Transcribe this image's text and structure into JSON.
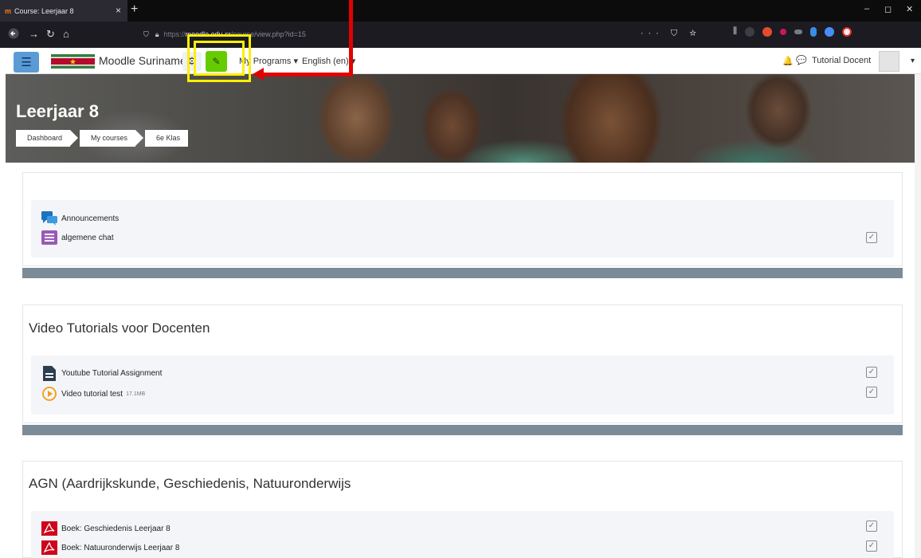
{
  "browser": {
    "tab_title": "Course: Leerjaar 8",
    "tab_logo": "m",
    "tab_close": "×",
    "new_tab": "+",
    "url_host": "moodle.edu.sr",
    "url_path": "/course/view.php?id=15",
    "url_prefix": "https://",
    "url_actions": "··· ⛉ ☆",
    "window_controls": [
      "–",
      "◻",
      "✕"
    ],
    "nav_icons": [
      "back-icon",
      "forward-icon",
      "reload-icon",
      "home-icon"
    ]
  },
  "moodle_nav": {
    "menu_icon": "☰",
    "brand": "Moodle Suriname",
    "gear_icon": "⚙",
    "edit_icon": "✎",
    "my_programs": "My Programs ▾",
    "language": "English (en) ▾",
    "bell_icon": "🔔",
    "chat_icon": "💬",
    "user_name": "Tutorial Docent",
    "user_caret": "▾",
    "flag_colors": [
      "#377e3f",
      "#ffffff",
      "#b40a2d",
      "#ecc81d"
    ]
  },
  "header": {
    "title": "Leerjaar 8",
    "breadcrumbs": [
      "Dashboard",
      "My courses",
      "6e Klas"
    ]
  },
  "sections": [
    {
      "title": "",
      "activities": [
        {
          "name": "Announcements",
          "icon": "forum-icon",
          "color": "#1e73be"
        },
        {
          "name": "algemene chat",
          "icon": "chat-icon",
          "color": "#9b59b6"
        }
      ]
    },
    {
      "title": "Video Tutorials voor Docenten",
      "activities": [
        {
          "name": "Youtube Tutorial Assignment",
          "icon": "assignment-icon",
          "color": "#2c3e50"
        },
        {
          "name": "Video tutorial test",
          "size": "17.1MB",
          "icon": "video-icon",
          "color": "#f39c12"
        }
      ]
    },
    {
      "title": "AGN (Aardrijkskunde, Geschiedenis, Natuuronderwijs",
      "activities": [
        {
          "name": "Boek: Geschiedenis Leerjaar 8",
          "icon": "pdf-icon",
          "color": "#d0021b"
        },
        {
          "name": "Boek: Natuuronderwijs Leerjaar 8",
          "icon": "pdf-icon",
          "color": "#d0021b"
        }
      ]
    }
  ],
  "colors": {
    "edit_button": "#66cc00",
    "highlight": "#ffee00",
    "arrow": "#e30000",
    "section_divider": "#7c8b98"
  }
}
